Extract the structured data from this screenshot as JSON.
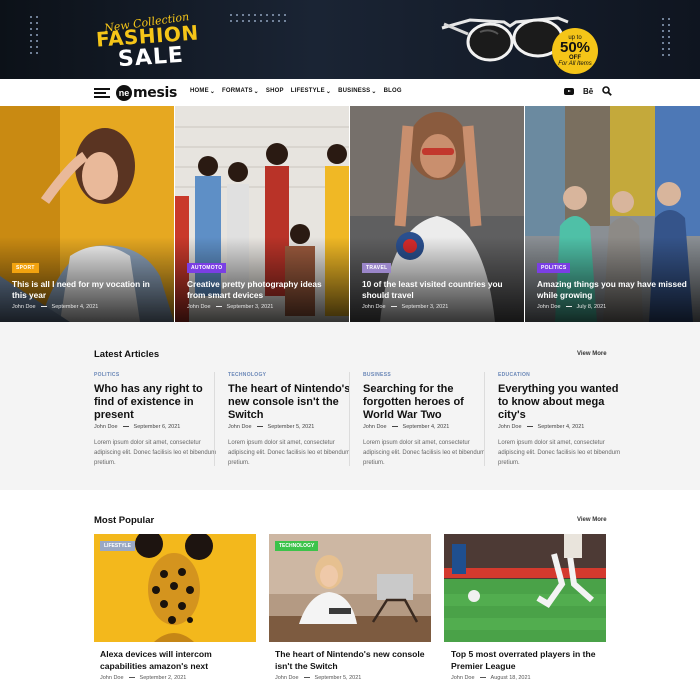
{
  "banner": {
    "promo_line1": "New Collection",
    "promo_line2": "FASHION",
    "promo_line3": "SALE",
    "tag_top": "up to",
    "tag_percent": "50%",
    "tag_off": "OFF",
    "tag_bottom": "For All Items"
  },
  "nav": {
    "logo_ne": "ne",
    "logo_rest": "mesis",
    "menu": [
      {
        "label": "HOME",
        "has_dropdown": true
      },
      {
        "label": "FORMATS",
        "has_dropdown": true
      },
      {
        "label": "SHOP",
        "has_dropdown": false
      },
      {
        "label": "LIFESTYLE",
        "has_dropdown": true
      },
      {
        "label": "BUSINESS",
        "has_dropdown": true
      },
      {
        "label": "BLOG",
        "has_dropdown": false
      }
    ],
    "icons": [
      "youtube-icon",
      "behance-icon",
      "search-icon"
    ],
    "behance_label": "Bē"
  },
  "hero": [
    {
      "category": "SPORT",
      "badge_color": "#f2a30f",
      "title": "This is all I need for my vocation in this year",
      "author": "John Doe",
      "date": "September 4, 2021"
    },
    {
      "category": "AUTOMOTO",
      "badge_color": "#7b3fe4",
      "title": "Creative pretty photography ideas from smart devices",
      "author": "John Doe",
      "date": "September 3, 2021"
    },
    {
      "category": "TRAVEL",
      "badge_color": "#9a86c9",
      "title": "10 of the least visited countries you should travel",
      "author": "John Doe",
      "date": "September 3, 2021"
    },
    {
      "category": "POLITICS",
      "badge_color": "#7b3fe4",
      "title": "Amazing things you may have missed while growing",
      "author": "John Doe",
      "date": "July 8, 2021"
    }
  ],
  "latest": {
    "title": "Latest Articles",
    "view_more": "View More",
    "articles": [
      {
        "category": "POLITICS",
        "title": "Who has any right to find of existence in present",
        "author": "John Doe",
        "date": "September 6, 2021",
        "excerpt": "Lorem ipsum dolor sit amet, consectetur adipiscing elit. Donec facilisis leo et bibendum pretium."
      },
      {
        "category": "TECHNOLOGY",
        "title": "The heart of Nintendo's new console isn't the Switch",
        "author": "John Doe",
        "date": "September 5, 2021",
        "excerpt": "Lorem ipsum dolor sit amet, consectetur adipiscing elit. Donec facilisis leo et bibendum pretium."
      },
      {
        "category": "BUSINESS",
        "title": "Searching for the forgotten heroes of World War Two",
        "author": "John Doe",
        "date": "September 4, 2021",
        "excerpt": "Lorem ipsum dolor sit amet, consectetur adipiscing elit. Donec facilisis leo et bibendum pretium."
      },
      {
        "category": "EDUCATION",
        "title": "Everything you wanted to know about mega city's",
        "author": "John Doe",
        "date": "September 4, 2021",
        "excerpt": "Lorem ipsum dolor sit amet, consectetur adipiscing elit. Donec facilisis leo et bibendum pretium."
      }
    ]
  },
  "popular": {
    "title": "Most Popular",
    "view_more": "View More",
    "posts": [
      {
        "category": "LIFESTYLE",
        "badge_color": "#9aa8c4",
        "title": "Alexa devices will intercom capabilities amazon's next",
        "author": "John Doe",
        "date": "September 2, 2021"
      },
      {
        "category": "TECHNOLOGY",
        "badge_color": "#3cc34a",
        "title": "The heart of Nintendo's new console isn't the Switch",
        "author": "John Doe",
        "date": "September 5, 2021"
      },
      {
        "category": "",
        "badge_color": "",
        "title": "Top 5 most overrated players in the Premier League",
        "author": "John Doe",
        "date": "August 18, 2021"
      }
    ]
  }
}
